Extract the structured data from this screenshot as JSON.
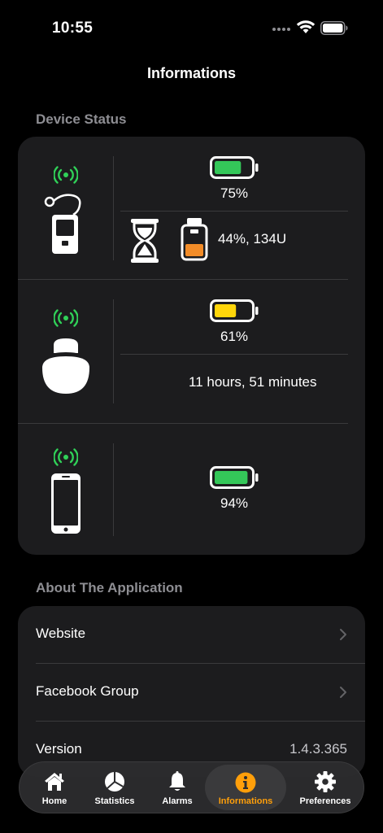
{
  "status_bar": {
    "time": "10:55"
  },
  "nav": {
    "title": "Informations"
  },
  "device_status": {
    "header": "Device Status",
    "pump": {
      "battery_pct": 75,
      "battery_text": "75%",
      "battery_color": "#34c759",
      "reservoir_pct": 44,
      "reservoir_text": "44%, 134U",
      "reservoir_color": "#f28c28"
    },
    "pod": {
      "battery_pct": 61,
      "battery_text": "61%",
      "battery_color": "#ffd60a",
      "remaining_text": "11 hours, 51 minutes"
    },
    "phone": {
      "battery_pct": 94,
      "battery_text": "94%",
      "battery_color": "#34c759"
    },
    "signal_color": "#30d158"
  },
  "about": {
    "header": "About The Application",
    "website_label": "Website",
    "facebook_label": "Facebook Group",
    "version_label": "Version",
    "version_value": "1.4.3.365"
  },
  "tab_bar": {
    "accent_color": "#ff9f0a",
    "tabs": [
      {
        "label": "Home",
        "icon": "house-icon"
      },
      {
        "label": "Statistics",
        "icon": "pie-chart-icon"
      },
      {
        "label": "Alarms",
        "icon": "bell-icon"
      },
      {
        "label": "Informations",
        "icon": "info-circle-icon",
        "active": true
      },
      {
        "label": "Preferences",
        "icon": "gear-icon"
      }
    ]
  }
}
